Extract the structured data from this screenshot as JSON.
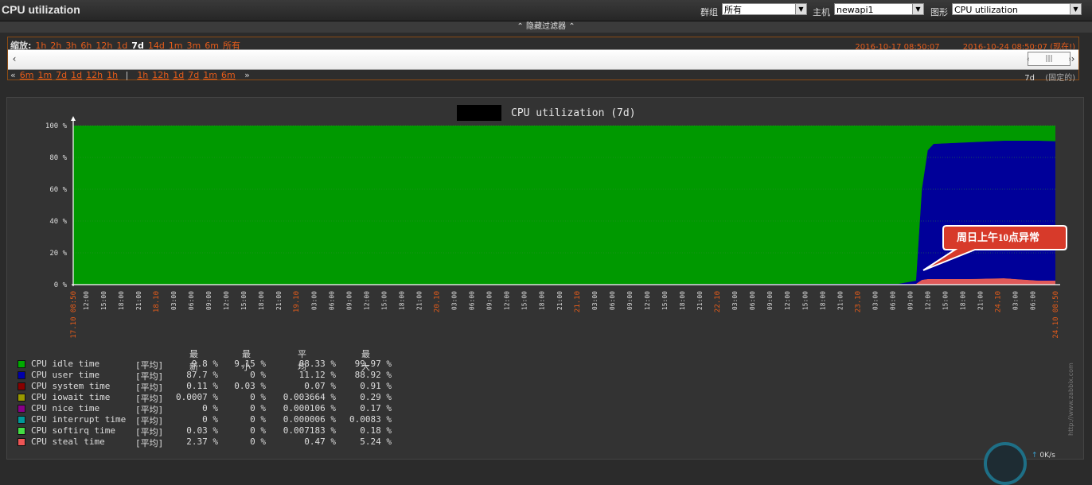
{
  "header": {
    "title": "CPU utilization",
    "group_label": "群组",
    "group_value": "所有",
    "host_label": "主机",
    "host_value": "newapi1",
    "graph_label": "图形",
    "graph_value": "CPU utilization"
  },
  "filter": {
    "toggle_label": "隐藏过滤器"
  },
  "timeline": {
    "zoom_label": "缩放:",
    "zoom_options": [
      "1h",
      "2h",
      "3h",
      "6h",
      "12h",
      "1d",
      "7d",
      "14d",
      "1m",
      "3m",
      "6m",
      "所有"
    ],
    "zoom_active": "7d",
    "date_from": "2016-10-17 08:50:07",
    "date_to": "2016-10-24 08:50:07",
    "now_label": "(现在!)",
    "back_label": "«",
    "back_options": [
      "6m",
      "1m",
      "7d",
      "1d",
      "12h",
      "1h"
    ],
    "separator": "|",
    "fwd_options": [
      "1h",
      "12h",
      "1d",
      "7d",
      "1m",
      "6m"
    ],
    "fwd_label": "»",
    "period_value": "7d",
    "fixed_label": "(固定的)"
  },
  "graph": {
    "title": "CPU utilization (7d)",
    "annotation": "周日上午10点异常",
    "watermark": "http://www.zabbix.com",
    "y_ticks": [
      "100 %",
      "80 %",
      "60 %",
      "40 %",
      "20 %",
      "0 %"
    ],
    "x_ticks": [
      {
        "t": "17.10 08:50",
        "major": true
      },
      {
        "t": "12:00"
      },
      {
        "t": "15:00"
      },
      {
        "t": "18:00"
      },
      {
        "t": "21:00"
      },
      {
        "t": "18.10",
        "major": true
      },
      {
        "t": "03:00"
      },
      {
        "t": "06:00"
      },
      {
        "t": "09:00"
      },
      {
        "t": "12:00"
      },
      {
        "t": "15:00"
      },
      {
        "t": "18:00"
      },
      {
        "t": "21:00"
      },
      {
        "t": "19.10",
        "major": true
      },
      {
        "t": "03:00"
      },
      {
        "t": "06:00"
      },
      {
        "t": "09:00"
      },
      {
        "t": "12:00"
      },
      {
        "t": "15:00"
      },
      {
        "t": "18:00"
      },
      {
        "t": "21:00"
      },
      {
        "t": "20.10",
        "major": true
      },
      {
        "t": "03:00"
      },
      {
        "t": "06:00"
      },
      {
        "t": "09:00"
      },
      {
        "t": "12:00"
      },
      {
        "t": "15:00"
      },
      {
        "t": "18:00"
      },
      {
        "t": "21:00"
      },
      {
        "t": "21.10",
        "major": true
      },
      {
        "t": "03:00"
      },
      {
        "t": "06:00"
      },
      {
        "t": "09:00"
      },
      {
        "t": "12:00"
      },
      {
        "t": "15:00"
      },
      {
        "t": "18:00"
      },
      {
        "t": "21:00"
      },
      {
        "t": "22.10",
        "major": true
      },
      {
        "t": "03:00"
      },
      {
        "t": "06:00"
      },
      {
        "t": "09:00"
      },
      {
        "t": "12:00"
      },
      {
        "t": "15:00"
      },
      {
        "t": "18:00"
      },
      {
        "t": "21:00"
      },
      {
        "t": "23.10",
        "major": true
      },
      {
        "t": "03:00"
      },
      {
        "t": "06:00"
      },
      {
        "t": "09:00"
      },
      {
        "t": "12:00"
      },
      {
        "t": "15:00"
      },
      {
        "t": "18:00"
      },
      {
        "t": "21:00"
      },
      {
        "t": "24.10",
        "major": true
      },
      {
        "t": "03:00"
      },
      {
        "t": "06:00"
      },
      {
        "t": "24.10 08:50",
        "major": true
      }
    ]
  },
  "legend": {
    "headers": [
      "最新",
      "最小",
      "平均",
      "最大"
    ],
    "items": [
      {
        "name": "CPU idle time",
        "func": "[平均]",
        "last": "9.8 %",
        "min": "9.15 %",
        "avg": "88.33 %",
        "max": "99.97 %",
        "color": "#00aa00"
      },
      {
        "name": "CPU user time",
        "func": "[平均]",
        "last": "87.7 %",
        "min": "0 %",
        "avg": "11.12 %",
        "max": "88.92 %",
        "color": "#0000aa"
      },
      {
        "name": "CPU system time",
        "func": "[平均]",
        "last": "0.11 %",
        "min": "0.03 %",
        "avg": "0.07 %",
        "max": "0.91 %",
        "color": "#880000"
      },
      {
        "name": "CPU iowait time",
        "func": "[平均]",
        "last": "0.0007 %",
        "min": "0 %",
        "avg": "0.003664 %",
        "max": "0.29 %",
        "color": "#999900"
      },
      {
        "name": "CPU nice time",
        "func": "[平均]",
        "last": "0 %",
        "min": "0 %",
        "avg": "0.000106 %",
        "max": "0.17 %",
        "color": "#880088"
      },
      {
        "name": "CPU interrupt time",
        "func": "[平均]",
        "last": "0 %",
        "min": "0 %",
        "avg": "0.000006 %",
        "max": "0.0083 %",
        "color": "#009999"
      },
      {
        "name": "CPU softirq time",
        "func": "[平均]",
        "last": "0.03 %",
        "min": "0 %",
        "avg": "0.007183 %",
        "max": "0.18 %",
        "color": "#44dd44"
      },
      {
        "name": "CPU steal time",
        "func": "[平均]",
        "last": "2.37 %",
        "min": "0 %",
        "avg": "0.47 %",
        "max": "5.24 %",
        "color": "#ee5555"
      }
    ]
  },
  "status": {
    "speed": "0K/s"
  },
  "chart_data": {
    "type": "area",
    "title": "CPU utilization (7d)",
    "ylim": [
      0,
      100
    ],
    "y_unit": "%",
    "xlim": [
      "2016-10-17 08:50",
      "2016-10-24 08:50"
    ],
    "x": [
      "2016-10-17 08:50",
      "2016-10-23 06:00",
      "2016-10-23 09:00",
      "2016-10-23 10:00",
      "2016-10-23 11:00",
      "2016-10-23 12:00",
      "2016-10-23 18:00",
      "2016-10-24 00:00",
      "2016-10-24 06:00",
      "2016-10-24 08:50"
    ],
    "series": [
      {
        "name": "CPU steal time",
        "values": [
          0,
          0,
          0.5,
          3,
          3.5,
          3.5,
          3.5,
          4,
          2.5,
          2.5
        ]
      },
      {
        "name": "CPU user time",
        "values": [
          0,
          0.5,
          2,
          57,
          81,
          85,
          86,
          86.5,
          88,
          87.7
        ]
      },
      {
        "name": "CPU idle time",
        "values": [
          100,
          99.5,
          97.5,
          40,
          15.5,
          11.5,
          10.5,
          9.5,
          9.5,
          9.8
        ]
      }
    ],
    "annotation": "周日上午10点异常"
  }
}
